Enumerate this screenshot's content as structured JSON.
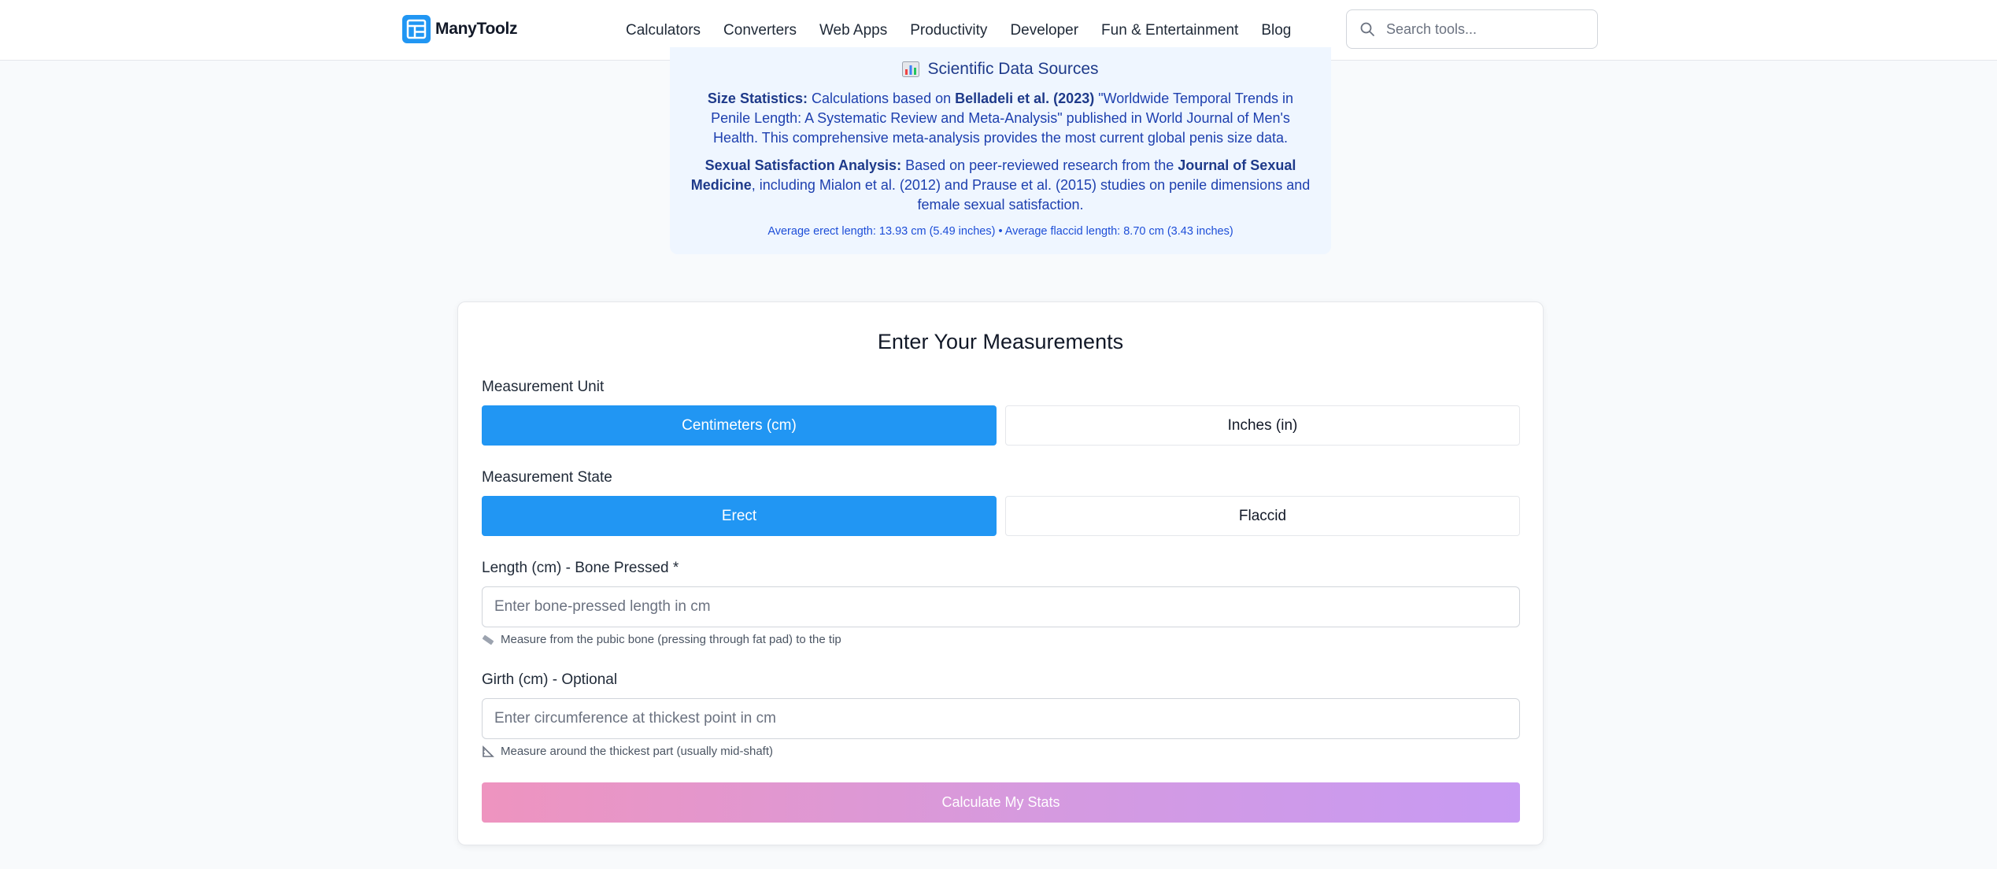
{
  "header": {
    "logo_text": "ManyToolz",
    "nav": [
      "Calculators",
      "Converters",
      "Web Apps",
      "Productivity",
      "Developer",
      "Fun & Entertainment",
      "Blog"
    ],
    "search_placeholder": "Search tools..."
  },
  "sources": {
    "title": "Scientific Data Sources",
    "p1_label": "Size Statistics:",
    "p1_text_a": "Calculations based on",
    "p1_author": "Belladeli et al. (2023)",
    "p1_text_b": "\"Worldwide Temporal Trends in Penile Length: A Systematic Review and Meta-Analysis\" published in World Journal of Men's Health. This comprehensive meta-analysis provides the most current global penis size data.",
    "p2_label": "Sexual Satisfaction Analysis:",
    "p2_text_a": "Based on peer-reviewed research from the",
    "p2_journal": "Journal of Sexual Medicine",
    "p2_text_b": ", including Mialon et al. (2012) and Prause et al. (2015) studies on penile dimensions and female sexual satisfaction.",
    "averages": "Average erect length: 13.93 cm (5.49 inches) • Average flaccid length: 8.70 cm (3.43 inches)"
  },
  "form": {
    "title": "Enter Your Measurements",
    "unit_label": "Measurement Unit",
    "unit_options": [
      "Centimeters (cm)",
      "Inches (in)"
    ],
    "state_label": "Measurement State",
    "state_options": [
      "Erect",
      "Flaccid"
    ],
    "length_label": "Length (cm) - Bone Pressed *",
    "length_placeholder": "Enter bone-pressed length in cm",
    "length_hint": "Measure from the pubic bone (pressing through fat pad) to the tip",
    "girth_label": "Girth (cm) - Optional",
    "girth_placeholder": "Enter circumference at thickest point in cm",
    "girth_hint": "Measure around the thickest part (usually mid-shaft)",
    "submit_label": "Calculate My Stats"
  },
  "colors": {
    "accent": "#2196f3",
    "sources_bg": "#eff6ff",
    "button_gradient_start": "#ee94bf",
    "button_gradient_end": "#c79af3"
  },
  "icons": {
    "logo": "calculator-grid-icon",
    "search": "search-icon",
    "sources": "bar-chart-icon",
    "length_hint": "ruler-icon",
    "girth_hint": "triangle-ruler-icon"
  }
}
